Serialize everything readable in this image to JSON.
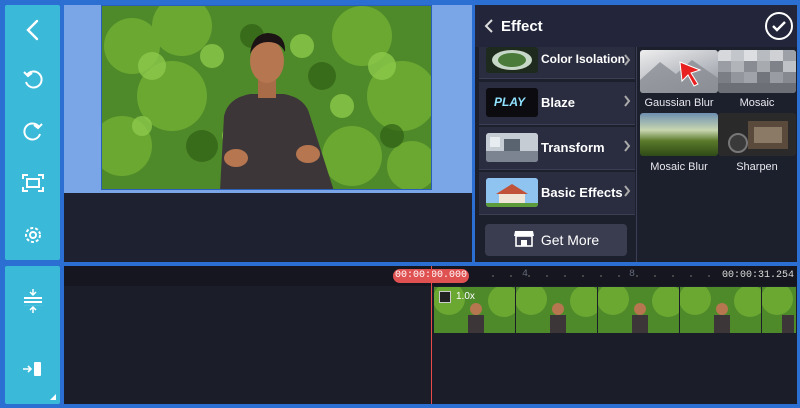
{
  "toolbar": {
    "icons": [
      "back-icon",
      "undo-icon",
      "redo-icon",
      "fullscreen-icon",
      "settings-icon",
      "split-icon",
      "import-icon"
    ]
  },
  "effect_panel": {
    "title": "Effect",
    "categories": [
      {
        "label": "Color Isolation",
        "thumb": "circle-thumbnail"
      },
      {
        "label": "Blaze",
        "thumb": "play-thumbnail",
        "thumb_text": "PLAY"
      },
      {
        "label": "Transform",
        "thumb": "room-thumbnail"
      },
      {
        "label": "Basic Effects",
        "thumb": "house-thumbnail"
      }
    ],
    "get_more_label": "Get More",
    "effects": [
      {
        "label": "Gaussian Blur"
      },
      {
        "label": "Mosaic"
      },
      {
        "label": "Mosaic Blur"
      },
      {
        "label": "Sharpen"
      }
    ]
  },
  "timeline": {
    "current_time": "00:00:00.000",
    "total_time": "00:00:31.254",
    "ticks": [
      "4",
      "8"
    ],
    "clip_speed": "1.0x"
  },
  "colors": {
    "accent_blue": "#3bb9d8",
    "playhead_red": "#e05252",
    "panel_bg": "#1c1f2c"
  }
}
